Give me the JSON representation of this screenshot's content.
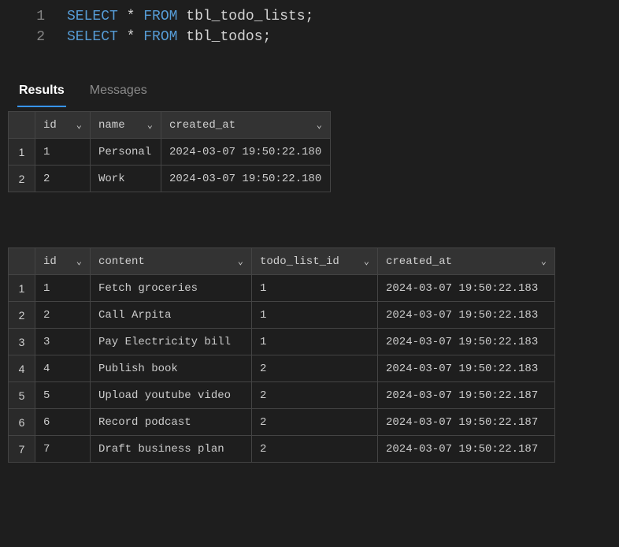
{
  "editor": {
    "lines": [
      {
        "num": "1",
        "select": "SELECT",
        "star": "*",
        "from": "FROM",
        "ident": "tbl_todo_lists",
        "semi": ";"
      },
      {
        "num": "2",
        "select": "SELECT",
        "star": "*",
        "from": "FROM",
        "ident": "tbl_todos",
        "semi": ";"
      }
    ]
  },
  "tabs": {
    "results": "Results",
    "messages": "Messages"
  },
  "table1": {
    "headers": {
      "id": "id",
      "name": "name",
      "created_at": "created_at"
    },
    "rows": [
      {
        "n": "1",
        "id": "1",
        "name": "Personal",
        "created_at": "2024-03-07 19:50:22.180"
      },
      {
        "n": "2",
        "id": "2",
        "name": "Work",
        "created_at": "2024-03-07 19:50:22.180"
      }
    ]
  },
  "table2": {
    "headers": {
      "id": "id",
      "content": "content",
      "todo_list_id": "todo_list_id",
      "created_at": "created_at"
    },
    "rows": [
      {
        "n": "1",
        "id": "1",
        "content": "Fetch groceries",
        "todo_list_id": "1",
        "created_at": "2024-03-07 19:50:22.183"
      },
      {
        "n": "2",
        "id": "2",
        "content": "Call Arpita",
        "todo_list_id": "1",
        "created_at": "2024-03-07 19:50:22.183"
      },
      {
        "n": "3",
        "id": "3",
        "content": "Pay Electricity bill",
        "todo_list_id": "1",
        "created_at": "2024-03-07 19:50:22.183"
      },
      {
        "n": "4",
        "id": "4",
        "content": "Publish book",
        "todo_list_id": "2",
        "created_at": "2024-03-07 19:50:22.183"
      },
      {
        "n": "5",
        "id": "5",
        "content": "Upload youtube video",
        "todo_list_id": "2",
        "created_at": "2024-03-07 19:50:22.187"
      },
      {
        "n": "6",
        "id": "6",
        "content": "Record podcast",
        "todo_list_id": "2",
        "created_at": "2024-03-07 19:50:22.187"
      },
      {
        "n": "7",
        "id": "7",
        "content": "Draft business plan",
        "todo_list_id": "2",
        "created_at": "2024-03-07 19:50:22.187"
      }
    ]
  },
  "chevron": "⌄"
}
